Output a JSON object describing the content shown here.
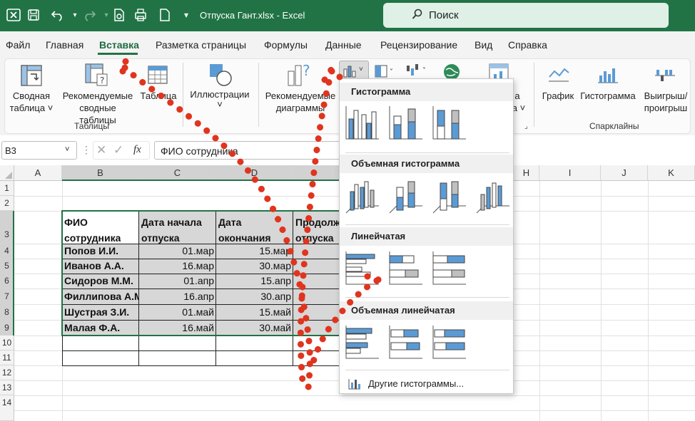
{
  "titlebar": {
    "file_title": "Отпуска Гант.xlsx  -  Excel",
    "search_placeholder": "Поиск"
  },
  "menu": [
    "Файл",
    "Главная",
    "Вставка",
    "Разметка страницы",
    "Формулы",
    "Данные",
    "Рецензирование",
    "Вид",
    "Справка"
  ],
  "ribbon": {
    "pivot_l1": "Сводная",
    "pivot_l2": "таблица ˅",
    "rec_pivot_l1": "Рекомендуемые",
    "rec_pivot_l2": "сводные таблицы",
    "table": "Таблица",
    "group_tables": "Таблицы",
    "illustrations": "Иллюстрации",
    "illustrations_chev": "˅",
    "rec_charts_l1": "Рекомендуемые",
    "rec_charts_l2": "диаграммы",
    "partial_a": "а",
    "partial_a_chev": "а ˅",
    "sparkline_line": "График",
    "sparkline_col": "Гистограмма",
    "sparkline_wl_l1": "Выигрыш/",
    "sparkline_wl_l2": "проигрыш",
    "group_sparklines": "Спарклайны"
  },
  "formula": {
    "name_box": "B3",
    "content": "ФИО сотрудника",
    "fx": "fx"
  },
  "columns": [
    "A",
    "B",
    "C",
    "D",
    "",
    "",
    "H",
    "I",
    "J",
    "K"
  ],
  "rows": [
    "1",
    "2",
    "3",
    "4",
    "5",
    "6",
    "7",
    "8",
    "9",
    "10",
    "11",
    "12",
    "13",
    "14"
  ],
  "table": {
    "headers": [
      {
        "l1": "ФИО",
        "l2": "сотрудника"
      },
      {
        "l1": "Дата начала",
        "l2": "отпуска"
      },
      {
        "l1": "Дата",
        "l2": "окончания"
      },
      {
        "l1": "Продолж",
        "l2": "отпуска"
      }
    ],
    "rows": [
      {
        "name": "Попов И.И.",
        "start": "01.мар",
        "end": "15.мар"
      },
      {
        "name": "Иванов А.А.",
        "start": "16.мар",
        "end": "30.мар"
      },
      {
        "name": "Сидоров М.М.",
        "start": "01.апр",
        "end": "15.апр"
      },
      {
        "name": "Филлипова А.М.",
        "start": "16.апр",
        "end": "30.апр"
      },
      {
        "name": "Шустрая З.И.",
        "start": "01.май",
        "end": "15.май"
      },
      {
        "name": "Малая Ф.А.",
        "start": "16.май",
        "end": "30.май"
      }
    ]
  },
  "dropdown": {
    "sections": [
      "Гистограмма",
      "Объемная гистограмма",
      "Линейчатая",
      "Объемная линейчатая"
    ],
    "more": "Другие гистограммы..."
  },
  "colors": {
    "excel_green": "#217346",
    "chart_blue": "#5b9bd5",
    "annotation_red": "#e0341f"
  }
}
